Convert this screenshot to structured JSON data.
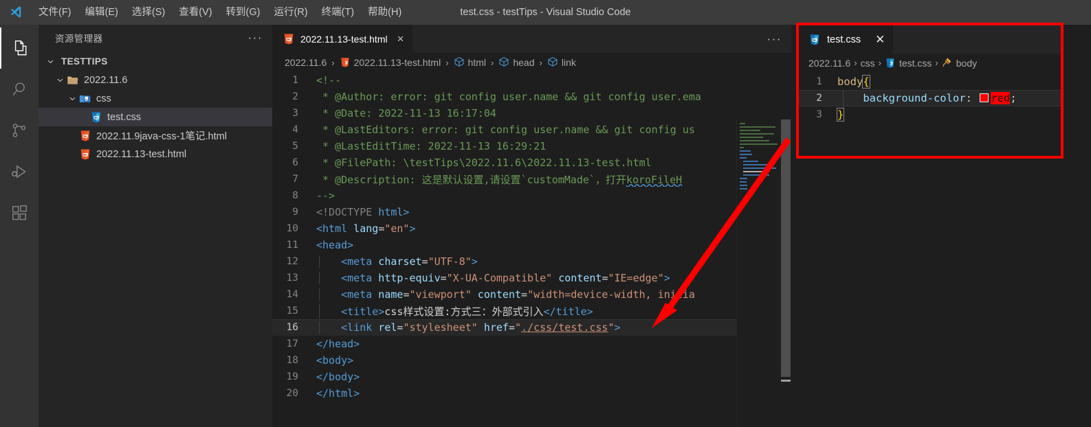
{
  "window": {
    "title": "test.css - testTips - Visual Studio Code",
    "logo": "vscode-logo"
  },
  "menu": [
    {
      "label": "文件(F)"
    },
    {
      "label": "编辑(E)"
    },
    {
      "label": "选择(S)"
    },
    {
      "label": "查看(V)"
    },
    {
      "label": "转到(G)"
    },
    {
      "label": "运行(R)"
    },
    {
      "label": "终端(T)"
    },
    {
      "label": "帮助(H)"
    }
  ],
  "activitybar": [
    {
      "name": "explorer-icon",
      "label": "资源管理器"
    },
    {
      "name": "search-icon",
      "label": "搜索"
    },
    {
      "name": "source-control-icon",
      "label": "源代码管理"
    },
    {
      "name": "run-debug-icon",
      "label": "运行和调试"
    },
    {
      "name": "extensions-icon",
      "label": "扩展"
    }
  ],
  "sidebar": {
    "title": "资源管理器",
    "more_label": "···",
    "tree": [
      {
        "label": "TESTTIPS",
        "kind": "root",
        "depth": 0,
        "expanded": true,
        "selected": false
      },
      {
        "label": "2022.11.6",
        "kind": "folder",
        "depth": 1,
        "expanded": true,
        "selected": false
      },
      {
        "label": "css",
        "kind": "cssfolder",
        "depth": 2,
        "expanded": true,
        "selected": false
      },
      {
        "label": "test.css",
        "kind": "css",
        "depth": 3,
        "expanded": null,
        "selected": true
      },
      {
        "label": "2022.11.9java-css-1笔记.html",
        "kind": "html",
        "depth": 2,
        "expanded": null,
        "selected": false
      },
      {
        "label": "2022.11.13-test.html",
        "kind": "html",
        "depth": 2,
        "expanded": null,
        "selected": false
      }
    ]
  },
  "editor": {
    "tab": {
      "label": "2022.11.13-test.html",
      "icon": "html5-icon",
      "close": "×"
    },
    "more_label": "···",
    "breadcrumb": [
      {
        "label": "2022.11.6",
        "icon": null
      },
      {
        "label": "2022.11.13-test.html",
        "icon": "html5-icon"
      },
      {
        "label": "html",
        "icon": "symbol-field-icon"
      },
      {
        "label": "head",
        "icon": "symbol-field-icon"
      },
      {
        "label": "link",
        "icon": "symbol-field-icon"
      }
    ],
    "separator": "›",
    "lines": [
      {
        "n": "1",
        "active": false
      },
      {
        "n": "2",
        "active": false
      },
      {
        "n": "3",
        "active": false
      },
      {
        "n": "4",
        "active": false
      },
      {
        "n": "5",
        "active": false
      },
      {
        "n": "6",
        "active": false
      },
      {
        "n": "7",
        "active": false
      },
      {
        "n": "8",
        "active": false
      },
      {
        "n": "9",
        "active": false
      },
      {
        "n": "10",
        "active": false
      },
      {
        "n": "11",
        "active": false
      },
      {
        "n": "12",
        "active": false
      },
      {
        "n": "13",
        "active": false
      },
      {
        "n": "14",
        "active": false
      },
      {
        "n": "15",
        "active": false
      },
      {
        "n": "16",
        "active": true
      },
      {
        "n": "17",
        "active": false
      },
      {
        "n": "18",
        "active": false
      },
      {
        "n": "19",
        "active": false
      },
      {
        "n": "20",
        "active": false
      }
    ],
    "code_text": {
      "l1": "<!--",
      "l2": " * @Author: error: git config user.name && git config user.ema",
      "l3": " * @Date: 2022-11-13 16:17:04",
      "l4": " * @LastEditors: error: git config user.name && git config us",
      "l5": " * @LastEditTime: 2022-11-13 16:29:21",
      "l6": " * @FilePath: \\testTips\\2022.11.6\\2022.11.13-test.html",
      "l7a": " * @Description: 这是默认设置,请设置`customMade`，打开",
      "l7b": "koroFileH",
      "l8": "-->",
      "l9a": "<!DOCTYPE",
      "l9b": " html>",
      "l10a": "<html",
      "l10b": " lang",
      "l10c": "=",
      "l10d": "\"en\"",
      "l10e": ">",
      "l11": "<head>",
      "l12a": "    <meta",
      "l12b": " charset",
      "l12c": "=",
      "l12d": "\"UTF-8\"",
      "l12e": ">",
      "l13a": "    <meta",
      "l13b": " http-equiv",
      "l13c": "=",
      "l13d": "\"X-UA-Compatible\"",
      "l13e": " content",
      "l13f": "=",
      "l13g": "\"IE=edge\"",
      "l13h": ">",
      "l14a": "    <meta",
      "l14b": " name",
      "l14c": "=",
      "l14d": "\"viewport\"",
      "l14e": " content",
      "l14f": "=",
      "l14g": "\"width=device-width, initia",
      "l15a": "    <title>",
      "l15b": "css样式设置:方式三：外部式引入",
      "l15c": "</title>",
      "l16a": "    <link",
      "l16b": " rel",
      "l16c": "=",
      "l16d": "\"stylesheet\"",
      "l16e": " href",
      "l16f": "=",
      "l16g": "\"",
      "l16h": "./css/test.css",
      "l16i": "\"",
      "l16j": ">",
      "l17": "</head>",
      "l18": "<body>",
      "l19": "</body>",
      "l20": "</html>"
    }
  },
  "css_editor": {
    "tab": {
      "label": "test.css",
      "icon": "css3-icon",
      "close": "✕"
    },
    "breadcrumb": [
      {
        "label": "2022.11.6",
        "icon": null
      },
      {
        "label": "css",
        "icon": null
      },
      {
        "label": "test.css",
        "icon": "css3-icon"
      },
      {
        "label": "body",
        "icon": "symbol-ruler-icon"
      }
    ],
    "separator": "›",
    "lines": [
      {
        "n": "1",
        "active": false
      },
      {
        "n": "2",
        "active": true
      },
      {
        "n": "3",
        "active": false
      }
    ],
    "code_text": {
      "l1_selector": "body",
      "l1_brace": "{",
      "l2_indent": "    ",
      "l2_prop": "background-color",
      "l2_colon": ": ",
      "l2_value": "red",
      "l2_semi": ";",
      "l3_brace": "}"
    }
  },
  "annotation": {
    "highlight_color": "#ff0000",
    "arrow_color": "#ff0000",
    "arrow_from": "test.css editor panel",
    "arrow_to": "link href=\"./css/test.css\""
  },
  "colors": {
    "titlebar_bg": "#3c3c3c",
    "activitybar_bg": "#333333",
    "sidebar_bg": "#252526",
    "editor_bg": "#1e1e1e",
    "selection_bg": "#37373d",
    "comment_green": "#6a9955",
    "tag_blue": "#569cd6",
    "attr_blue": "#9cdcfe",
    "string_orange": "#ce9178",
    "selector_gold": "#d7ba7d",
    "brace_yellow": "#ffd700"
  }
}
